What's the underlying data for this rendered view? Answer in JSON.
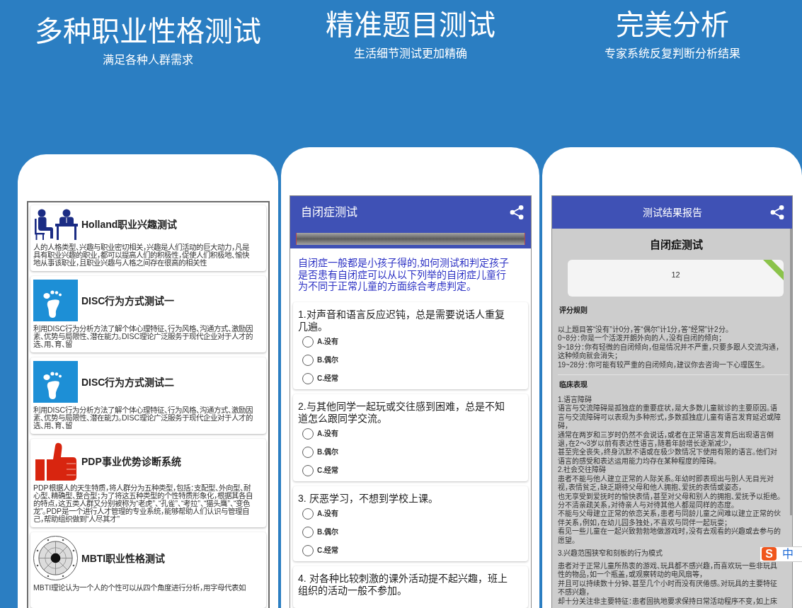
{
  "banners": [
    {
      "title": "多种职业性格测试",
      "subtitle": "满足各种人群需求"
    },
    {
      "title": "精准题目测试",
      "subtitle": "生活细节测试更加精确"
    },
    {
      "title": "完美分析",
      "subtitle": "专家系统反复判断分析结果"
    }
  ],
  "test_list": {
    "cards": [
      {
        "kind": "people",
        "title": "Holland职业兴趣测试",
        "description": "人的人格类型、兴趣与职业密切相关，兴趣是人们活动的巨大动力，凡是具有职业兴趣的职业，都可以提高人们的积极性，促使人们积极地、愉快地从事该职业，且职业兴趣与人格之间存在很高的相关性"
      },
      {
        "kind": "footprint",
        "title": "DISC行为方式测试一",
        "description": "利用DISC行为分析方法了解个体心理特征、行为风格、沟通方式、激励因素、优势与局限性、潜在能力。DISC理论广泛服务于现代企业对于人才的选、用、育、留"
      },
      {
        "kind": "footprint",
        "title": "DISC行为方式测试二",
        "description": "利用DISC行为分析方法了解个体心理特征、行为风格、沟通方式、激励因素、优势与局限性、潜在能力。DISC理论广泛服务于现代企业对于人才的选、用、育、留"
      },
      {
        "kind": "thumbs",
        "title": "PDP事业优势诊断系统",
        "description": "PDP根据人的天生特质，将人群分为五种类型，包括：支配型、外向型、耐心型、精确型、整合型；为了将这五种类型的个性特质形象化，根据其各自的特点，这五类人群又分别被称为“老虎”、“孔雀”、“考拉”、“猫头鹰”、“变色龙”。PDP是一个进行人才管理的专业系统，能够帮助人们认识与管理自己，帮助组织做到“人尽其才”"
      },
      {
        "kind": "dial",
        "title": "MBTI职业性格测试",
        "description": "MBTI理论认为一个人的个性可以从四个角度进行分析，用字母代表如"
      }
    ]
  },
  "quiz": {
    "title": "自闭症测试",
    "intro": "自闭症一般都是小孩子得的,如何测试和判定孩子是否患有自闭症可以从以下列举的自闭症儿童行为不同于正常儿童的方面综合考虑判定。",
    "questions": [
      {
        "text": "1.对声音和语言反应迟钝，总是需要说话人重复几遍。",
        "options": [
          {
            "label": "A.没有",
            "selected": false
          },
          {
            "label": "B.偶尔",
            "selected": false
          },
          {
            "label": "C.经常",
            "selected": false
          }
        ]
      },
      {
        "text": "2.与其他同学一起玩或交往感到困难，总是不知道怎么跟同学交流。",
        "options": [
          {
            "label": "A.没有",
            "selected": false
          },
          {
            "label": "B.偶尔",
            "selected": false
          },
          {
            "label": "C.经常",
            "selected": false
          }
        ]
      },
      {
        "text": "3. 厌恶学习，不想到学校上课。",
        "options": [
          {
            "label": "A.没有",
            "selected": false
          },
          {
            "label": "B.偶尔",
            "selected": false
          },
          {
            "label": "C.经常",
            "selected": false
          }
        ]
      },
      {
        "text": "4. 对各种比较刺激的课外活动提不起兴趣，班上组织的活动一般不参加。"
      }
    ]
  },
  "report": {
    "title": "测试结果报告",
    "test_name": "自闭症测试",
    "score": "12",
    "sections": [
      {
        "heading": "评分规则",
        "paragraphs": [
          "以上题目答“没有”计0分，答“偶尔”计1分，答“经常”计2分。",
          "0~8分：你是一个活泼开朗外向的人，没有自闭的倾向；",
          "9~18分：你有轻微的自闭倾向，但是情况并不严重，只要多跟人交流沟通，这种倾向就会消失；",
          "19~28分：你可能有较严重的自闭倾向，建议你去咨询一下心理医生。"
        ]
      },
      {
        "heading": "临床表现",
        "paragraphs": [
          "1.语言障碍",
          "语言与交流障碍是孤独症的重要症状，是大多数儿童就诊的主要原因。语言与交流障碍可以表现为多种形式，多数孤独症儿童有语言发育延迟或障碍，",
          "通常在两岁和三岁时仍然不会说话，或者在正常语言发育后出现语言倒退，在2～3岁以前有表达性语言，随着年龄增长逐渐减少，",
          "甚至完全丧失，终身沉默不语或在极少数情况下使用有限的语言。他们对语言的感受和表达运用能力均存在某种程度的障碍。",
          "2.社会交往障碍",
          "患者不能与他人建立正常的人际关系。年幼时即表现出与别人无目光对视，表情贫乏，缺乏期待父母和他人拥抱、爱抚的表情或姿态，",
          "也无享受到爱抚时的愉快表情，甚至对父母和别人的拥抱、爱抚予以拒绝。",
          "分不清亲疏关系，对待亲人与对待其他人都是同样的态度。",
          "不能与父母建立正常的依恋关系，患者与同龄儿童之间难以建立正常的伙伴关系，例如，在幼儿园多独处，不喜欢与同伴一起玩耍；",
          "看见一些儿童在一起兴致勃勃地做游戏时，没有去观看的兴趣或去参与的愿望。",
          "3.兴趣范围狭窄和刻板的行为模式",
          "患者对于正常儿童所热衷的游戏、玩具都不感兴趣，而喜欢玩一些非玩具性的物品，如一个瓶盖，或观察转动的电风扇等，",
          "并且可以持续数十分钟、甚至几个小时而没有厌倦感。对玩具的主要特征不感兴趣，",
          "却十分关注非主要特征：患者固执地要求保持日常活动程序不变，如上床"
        ]
      }
    ]
  },
  "ime_toolbar": {
    "logo": "S",
    "mode": "中"
  }
}
